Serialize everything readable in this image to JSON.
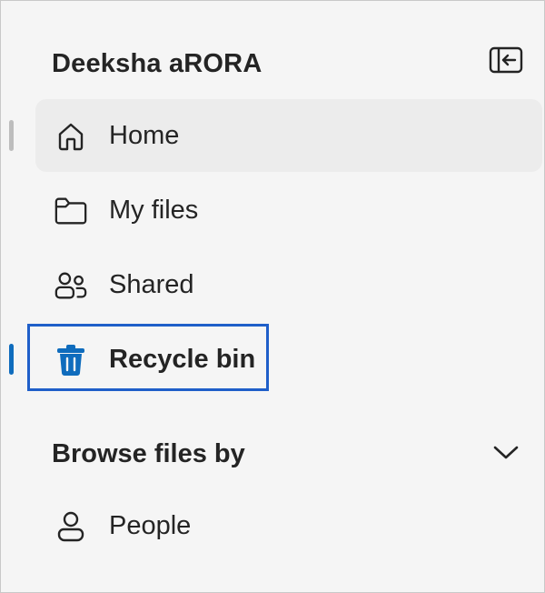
{
  "header": {
    "user_name": "Deeksha aRORA",
    "collapse_icon": "panel-collapse-icon"
  },
  "nav": {
    "items": [
      {
        "label": "Home",
        "icon": "home-icon",
        "state": "hovered"
      },
      {
        "label": "My files",
        "icon": "folder-icon",
        "state": "normal"
      },
      {
        "label": "Shared",
        "icon": "people-shared-icon",
        "state": "normal"
      },
      {
        "label": "Recycle bin",
        "icon": "trash-icon",
        "state": "selected"
      }
    ]
  },
  "browse": {
    "title": "Browse files by",
    "toggle_icon": "chevron-down-icon",
    "items": [
      {
        "label": "People",
        "icon": "person-icon"
      }
    ]
  },
  "colors": {
    "accent": "#0f6cbd",
    "highlight_border": "#1f5fc9",
    "text": "#242424",
    "hover_bg": "#ececec",
    "background": "#f5f5f5"
  }
}
